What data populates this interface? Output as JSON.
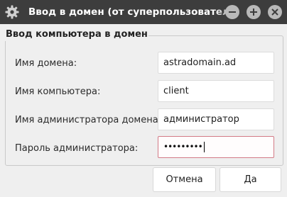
{
  "window": {
    "title": "Ввод в домен (от суперпользователя)",
    "app_icon": "gear-icon",
    "controls": [
      "minimize-icon",
      "maximize-icon",
      "close-icon"
    ]
  },
  "group": {
    "title": "Ввод компьютера в домен"
  },
  "fields": {
    "domain": {
      "label": "Имя домена:",
      "value": "astradomain.ad"
    },
    "computer": {
      "label": "Имя компьютера:",
      "value": "client"
    },
    "admin": {
      "label": "Имя администратора домена:",
      "value": "администратор"
    },
    "password": {
      "label": "Пароль администратора:",
      "value": "•••••••••"
    }
  },
  "buttons": {
    "cancel": "Отмена",
    "ok": "Да"
  },
  "colors": {
    "titlebar": "#3d3d3d",
    "window_bg": "#efefef",
    "password_border": "#d27a86"
  }
}
